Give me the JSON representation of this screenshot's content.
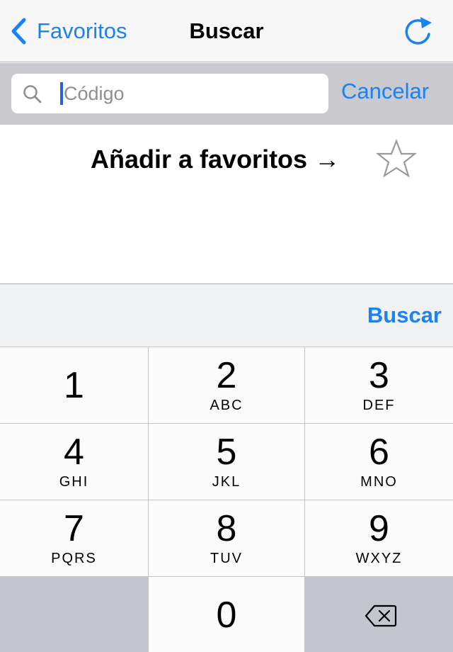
{
  "navbar": {
    "back_label": "Favoritos",
    "title": "Buscar",
    "back_icon": "chevron-left-icon",
    "refresh_icon": "refresh-icon"
  },
  "search": {
    "placeholder": "Código",
    "value": "",
    "cancel_label": "Cancelar",
    "icon": "search-icon"
  },
  "content": {
    "favorite_hint": "Añadir a favoritos →",
    "star_icon": "star-outline-icon"
  },
  "keyboard": {
    "action_label": "Buscar",
    "keys": [
      {
        "digit": "1",
        "letters": ""
      },
      {
        "digit": "2",
        "letters": "ABC"
      },
      {
        "digit": "3",
        "letters": "DEF"
      },
      {
        "digit": "4",
        "letters": "GHI"
      },
      {
        "digit": "5",
        "letters": "JKL"
      },
      {
        "digit": "6",
        "letters": "MNO"
      },
      {
        "digit": "7",
        "letters": "PQRS"
      },
      {
        "digit": "8",
        "letters": "TUV"
      },
      {
        "digit": "9",
        "letters": "WXYZ"
      },
      {
        "digit": "0",
        "letters": ""
      }
    ],
    "delete_icon": "backspace-icon"
  },
  "colors": {
    "accent": "#1a82f7",
    "navbar_bg": "#f7f7f7",
    "searchbar_bg": "#c9c9ce",
    "keyboard_bg": "#f0f1f2",
    "key_dark": "#c3c6cc"
  }
}
